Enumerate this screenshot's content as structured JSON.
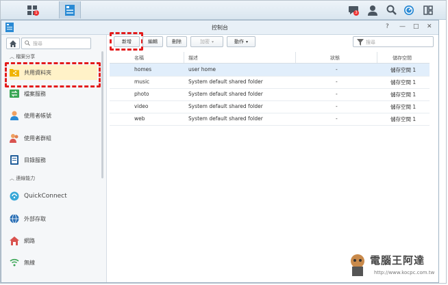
{
  "taskbar": {
    "left_badge": "1",
    "notify_badge": "3"
  },
  "window": {
    "title": "控制台",
    "buttons": {
      "help": "?",
      "minimize": "—",
      "maximize": "□",
      "close": "✕"
    }
  },
  "sidebar": {
    "search_placeholder": "搜尋",
    "sections": [
      {
        "label": "檔案分享"
      },
      {
        "label": "連線能力"
      }
    ],
    "items": [
      {
        "label": "共用資料夾",
        "icon": "shared-folder-icon"
      },
      {
        "label": "檔案服務",
        "icon": "file-services-icon"
      },
      {
        "label": "使用者帳號",
        "icon": "user-icon"
      },
      {
        "label": "使用者群組",
        "icon": "group-icon"
      },
      {
        "label": "目錄服務",
        "icon": "directory-icon"
      },
      {
        "label": "QuickConnect",
        "icon": "quickconnect-icon"
      },
      {
        "label": "外部存取",
        "icon": "globe-icon"
      },
      {
        "label": "網路",
        "icon": "network-icon"
      },
      {
        "label": "無線",
        "icon": "wifi-icon"
      }
    ]
  },
  "toolbar": {
    "create": "新增",
    "edit": "編輯",
    "delete": "刪除",
    "encrypt": "加密",
    "action": "動作",
    "search_placeholder": "搜尋"
  },
  "table": {
    "columns": [
      "名稱",
      "描述",
      "狀態",
      "儲存空間"
    ],
    "rows": [
      {
        "name": "homes",
        "desc": "user home",
        "status": "-",
        "volume": "儲存空間 1"
      },
      {
        "name": "music",
        "desc": "System default shared folder",
        "status": "-",
        "volume": "儲存空間 1"
      },
      {
        "name": "photo",
        "desc": "System default shared folder",
        "status": "-",
        "volume": "儲存空間 1"
      },
      {
        "name": "video",
        "desc": "System default shared folder",
        "status": "-",
        "volume": "儲存空間 1"
      },
      {
        "name": "web",
        "desc": "System default shared folder",
        "status": "-",
        "volume": "儲存空間 1"
      }
    ]
  },
  "watermark": {
    "text": "電腦王阿達",
    "url": "http://www.kocpc.com.tw"
  },
  "colors": {
    "highlight": "#e31b1b",
    "selected_row": "#e1eefb",
    "accent": "#2a8ad4"
  }
}
